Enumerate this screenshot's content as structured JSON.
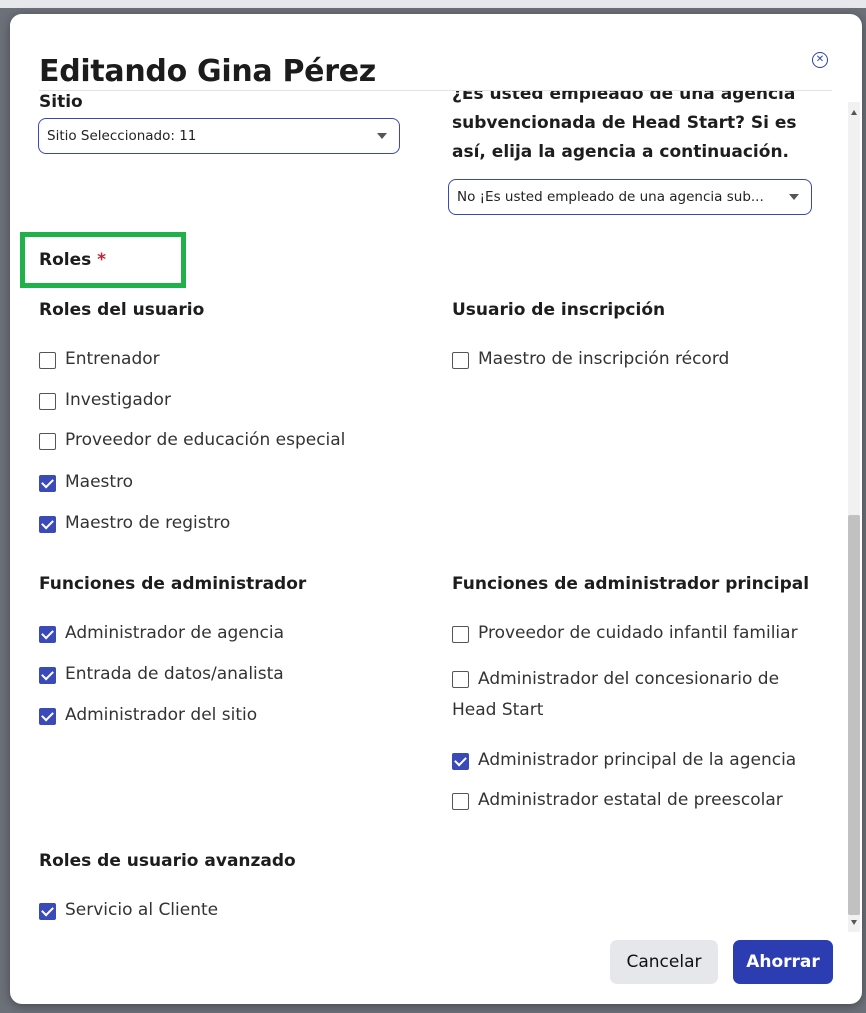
{
  "modal": {
    "title": "Editando Gina Pérez",
    "close_icon": "close-circle-icon"
  },
  "site": {
    "label": "Sitio",
    "select_value": "Sitio Seleccionado: 11"
  },
  "head_start": {
    "question": [
      "¿Es usted empleado de una agencia",
      "subvencionada de Head Start? Si es",
      "así, elija la agencia a continuación."
    ],
    "select_value": "No ¡Es usted empleado de una agencia sub..."
  },
  "roles": {
    "heading": "Roles",
    "required_mark": "*",
    "user_roles": {
      "title": "Roles del usuario",
      "items": [
        {
          "label": "Entrenador",
          "checked": false
        },
        {
          "label": "Investigador",
          "checked": false
        },
        {
          "label": "Proveedor de educación especial",
          "checked": false
        },
        {
          "label": "Maestro",
          "checked": true
        },
        {
          "label": "Maestro de registro",
          "checked": true
        }
      ]
    },
    "enrollment_user": {
      "title": "Usuario de inscripción",
      "items": [
        {
          "label": "Maestro de inscripción récord",
          "checked": false
        }
      ]
    },
    "admin_roles": {
      "title": "Funciones de administrador",
      "items": [
        {
          "label": "Administrador de agencia",
          "checked": true
        },
        {
          "label": "Entrada de datos/analista",
          "checked": true
        },
        {
          "label": "Administrador del sitio",
          "checked": true
        }
      ]
    },
    "principal_admin_roles": {
      "title": "Funciones de administrador principal",
      "items": [
        {
          "label": "Proveedor de cuidado infantil familiar",
          "checked": false
        },
        {
          "label": "Administrador del concesionario de",
          "label_line2": "Head Start",
          "checked": false
        },
        {
          "label": "Administrador principal de la agencia",
          "checked": true
        },
        {
          "label": "Administrador estatal de preescolar",
          "checked": false
        }
      ]
    },
    "advanced_roles": {
      "title": "Roles de usuario avanzado",
      "items": [
        {
          "label": "Servicio al Cliente",
          "checked": true
        }
      ]
    }
  },
  "footer": {
    "cancel_label": "Cancelar",
    "save_label": "Ahorrar"
  },
  "colors": {
    "primary": "#2b3db0",
    "checkbox_checked": "#3a4ab8",
    "required": "#d21f2f",
    "highlight": "#21b14a"
  }
}
